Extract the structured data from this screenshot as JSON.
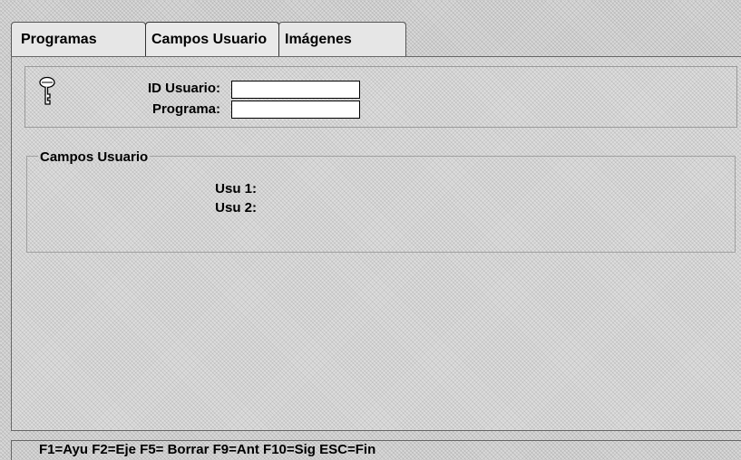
{
  "tabs": [
    {
      "label": "Programas",
      "active": false
    },
    {
      "label": "Campos Usuario",
      "active": true
    },
    {
      "label": "Imágenes",
      "active": false
    }
  ],
  "id_section": {
    "icon": "key-icon",
    "user_id_label": "ID Usuario:",
    "user_id_value": "",
    "program_label": "Programa:",
    "program_value": ""
  },
  "user_fields": {
    "title": "Campos Usuario",
    "field1_label": "Usu 1:",
    "field2_label": "Usu 2:"
  },
  "status_bar": {
    "text": "F1=Ayu  F2=Eje  F5= Borrar  F9=Ant  F10=Sig  ESC=Fin"
  }
}
